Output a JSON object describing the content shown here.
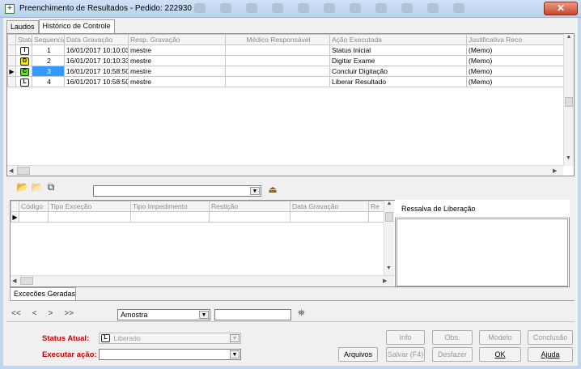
{
  "window": {
    "title": "Preenchimento de Resultados - Pedido: 222930",
    "close_glyph": "✕"
  },
  "tabs": [
    "Laudos",
    "Histórico de Controle"
  ],
  "history_table": {
    "columns": [
      "Status",
      "Sequencial",
      "Data Gravação",
      "Resp. Gravação",
      "Médico Responsável",
      "Ação Executada",
      "Justificativa Reco"
    ],
    "rows": [
      {
        "badge": "I",
        "badge_color": "#ffffff",
        "seq": "1",
        "date": "16/01/2017 10:10:03",
        "resp": "mestre",
        "medico": "",
        "acao": "Status Inicial",
        "just": "(Memo)"
      },
      {
        "badge": "D",
        "badge_color": "#f5e600",
        "seq": "2",
        "date": "16/01/2017 10:10:33",
        "resp": "mestre",
        "medico": "",
        "acao": "Digitar Exame",
        "just": "(Memo)"
      },
      {
        "badge": "C",
        "badge_color": "#66dd33",
        "seq": "3",
        "date": "16/01/2017 10:58:50",
        "resp": "mestre",
        "medico": "",
        "acao": "Concluir Digitação",
        "just": "(Memo)"
      },
      {
        "badge": "L",
        "badge_color": "#ffffff",
        "seq": "4",
        "date": "16/01/2017 10:58:50",
        "resp": "mestre",
        "medico": "",
        "acao": "Liberar Resultado",
        "just": "(Memo)"
      }
    ],
    "selected_row": 3
  },
  "exceptions_table": {
    "columns": [
      "Código",
      "Tipo Exceção",
      "Tipo Impedimento",
      "Restição",
      "Data Gravação",
      "Re"
    ]
  },
  "ressalva": {
    "title": "Ressalva de Liberação"
  },
  "exceptions_tab": "Excecões Geradas",
  "nav": {
    "first": "<<",
    "prev": "<",
    "next": ">",
    "last": ">>",
    "field_value": "Amostra",
    "search_value": ""
  },
  "status": {
    "current_label": "Status Atual:",
    "current_badge": "L",
    "current_value": "Liberado",
    "action_label": "Executar ação:",
    "action_value": ""
  },
  "buttons": {
    "info": "Info",
    "obs": "Obs.",
    "modelo": "Modelo",
    "conclusao": "Conclusão",
    "arquivos": "Arquivos",
    "salvar": "Salvar (F4)",
    "desfazer": "Desfazer",
    "ok": "OK",
    "ajuda": "Ajuda"
  },
  "colors": {
    "accent_selection": "#3399ff",
    "status_label": "#d00000"
  }
}
